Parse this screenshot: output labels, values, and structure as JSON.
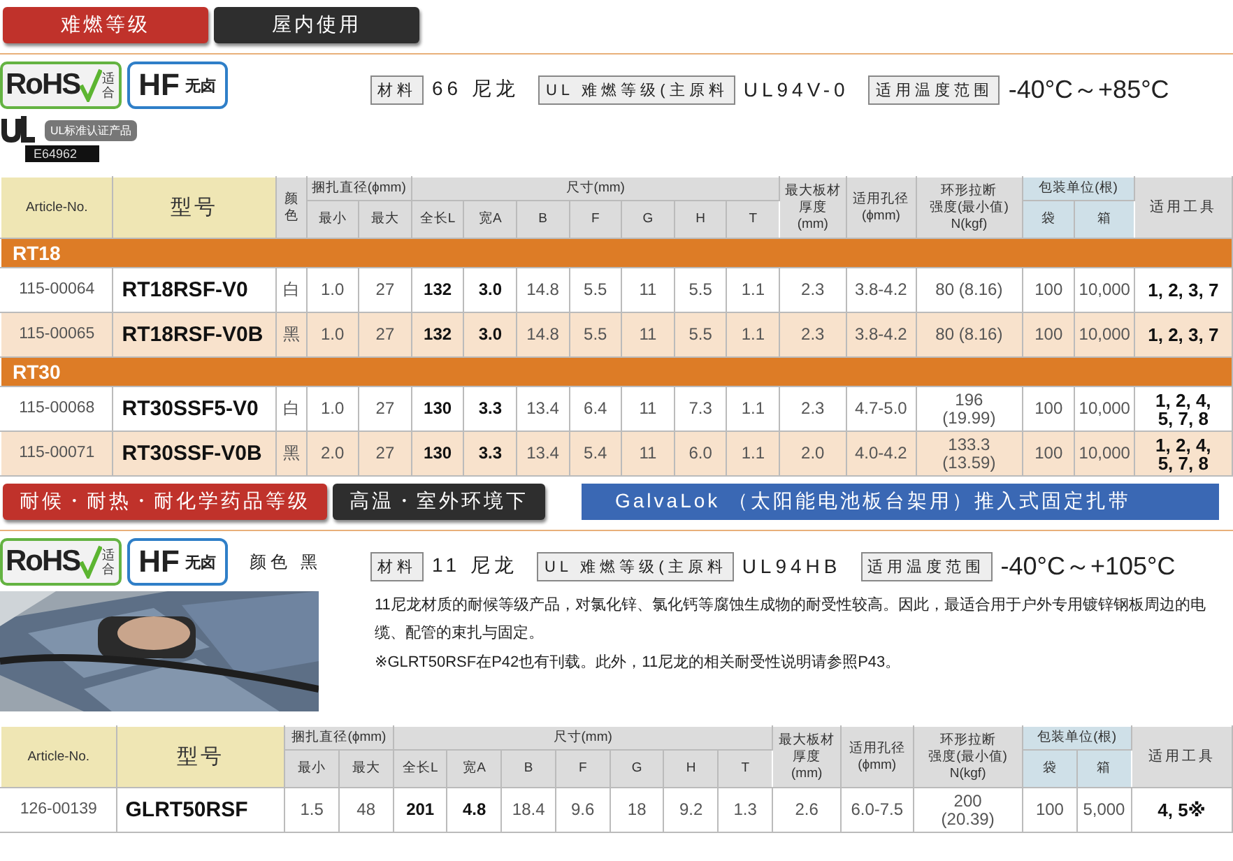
{
  "sections": [
    {
      "tags": [
        {
          "label": "难燃等级",
          "color": "#c0322b"
        },
        {
          "label": "屋内使用",
          "color": "#2e2e2e"
        }
      ],
      "rohs": {
        "mark": "RoHS",
        "label": "适合"
      },
      "hf": {
        "mark": "HF",
        "label": "无卤"
      },
      "ul": {
        "label": "UL标准认证产品",
        "number": "E64962"
      },
      "specs": [
        {
          "label": "材料",
          "value": "66 尼龙"
        },
        {
          "label": "UL 难燃等级(主原料",
          "value": "UL94V-0"
        },
        {
          "label": "适用温度范围",
          "value": "-40°C～+85°C",
          "kind": "temp"
        }
      ],
      "table": {
        "columns": [
          {
            "lines": [
              "Article-No."
            ],
            "kind": "id"
          },
          {
            "lines": [
              "型号"
            ],
            "kind": "model"
          },
          {
            "lines": [
              "颜",
              "色"
            ],
            "kind": "narrow"
          },
          {
            "lines": [
              "捆扎直径(ϕmm)"
            ],
            "colspan": 2,
            "subs": [
              {
                "label": "最小"
              },
              {
                "label": "最大"
              }
            ]
          },
          {
            "lines": [
              "尺寸(mm)"
            ],
            "colspan": 7,
            "subs": [
              {
                "label": "全长L",
                "kind": "key"
              },
              {
                "label": "宽A",
                "kind": "key"
              },
              {
                "label": "B"
              },
              {
                "label": "F"
              },
              {
                "label": "G"
              },
              {
                "label": "H"
              },
              {
                "label": "T"
              }
            ]
          },
          {
            "lines": [
              "最大板材",
              "厚度",
              "(mm)"
            ],
            "kind": "thick"
          },
          {
            "lines": [
              "适用孔径",
              "(ϕmm)"
            ],
            "kind": "hole"
          },
          {
            "lines": [
              "环形拉断",
              "强度(最小值)",
              "N(kgf)"
            ],
            "kind": "tensile"
          },
          {
            "lines": [
              "包装单位(根)"
            ],
            "kind": "pack",
            "colspan": 2,
            "subs": [
              {
                "label": "袋"
              },
              {
                "label": "箱"
              }
            ]
          },
          {
            "lines": [
              "适用工具"
            ],
            "kind": "tools"
          }
        ],
        "rows": [
          {
            "kind": "group",
            "label": "RT18"
          },
          {
            "kind": "item",
            "shaded": false,
            "cells": [
              "115-00064",
              "RT18RSF-V0",
              "白",
              "1.0",
              "27",
              "132",
              "3.0",
              "14.8",
              "5.5",
              "11",
              "5.5",
              "1.1",
              "2.3",
              "3.8-4.2",
              "80 (8.16)",
              "100",
              "10,000",
              "1, 2, 3, 7"
            ]
          },
          {
            "kind": "item",
            "shaded": true,
            "cells": [
              "115-00065",
              "RT18RSF-V0B",
              "黑",
              "1.0",
              "27",
              "132",
              "3.0",
              "14.8",
              "5.5",
              "11",
              "5.5",
              "1.1",
              "2.3",
              "3.8-4.2",
              "80 (8.16)",
              "100",
              "10,000",
              "1, 2, 3, 7"
            ]
          },
          {
            "kind": "group",
            "label": "RT30"
          },
          {
            "kind": "item",
            "shaded": false,
            "cells": [
              "115-00068",
              "RT30SSF5-V0",
              "白",
              "1.0",
              "27",
              "130",
              "3.3",
              "13.4",
              "6.4",
              "11",
              "7.3",
              "1.1",
              "2.3",
              "4.7-5.0",
              "196\n(19.99)",
              "100",
              "10,000",
              "1, 2, 4,\n5, 7, 8"
            ]
          },
          {
            "kind": "item",
            "shaded": true,
            "cells": [
              "115-00071",
              "RT30SSF-V0B",
              "黑",
              "2.0",
              "27",
              "130",
              "3.3",
              "13.4",
              "5.4",
              "11",
              "6.0",
              "1.1",
              "2.0",
              "4.0-4.2",
              "133.3\n(13.59)",
              "100",
              "10,000",
              "1, 2, 4,\n5, 7, 8"
            ]
          }
        ]
      }
    },
    {
      "tags": [
        {
          "label": "耐候・耐热・耐化学药品等级",
          "color": "#c0322b"
        },
        {
          "label": "高温・室外环境下",
          "color": "#2e2e2e"
        },
        {
          "label": "GalvaLok （太阳能电池板台架用）推入式固定扎带",
          "color": "#3a68b4",
          "kind": "wide"
        }
      ],
      "rohs": {
        "mark": "RoHS",
        "label": "适合"
      },
      "hf": {
        "mark": "HF",
        "label": "无卤"
      },
      "note": "颜色 黑",
      "specs": [
        {
          "label": "材料",
          "value": "11 尼龙"
        },
        {
          "label": "UL 难燃等级(主原料",
          "value": "UL94HB"
        },
        {
          "label": "适用温度范围",
          "value": "-40°C～+105°C",
          "kind": "temp"
        }
      ],
      "photo": {
        "kind": "picture"
      },
      "description": [
        "11尼龙材质的耐候等级产品，对氯化锌、氯化钙等腐蚀生成物的耐受性较高。因此，最适合用于户外专用镀锌钢板周边的电缆、配管的束扎与固定。",
        "※GLRT50RSF在P42也有刊载。此外，11尼龙的相关耐受性说明请参照P43。"
      ],
      "table": {
        "columns": [
          {
            "lines": [
              "Article-No."
            ],
            "kind": "id"
          },
          {
            "lines": [
              "型号"
            ],
            "kind": "model"
          },
          {
            "lines": [
              "捆扎直径(ϕmm)"
            ],
            "colspan": 2,
            "subs": [
              {
                "label": "最小"
              },
              {
                "label": "最大"
              }
            ]
          },
          {
            "lines": [
              "尺寸(mm)"
            ],
            "colspan": 7,
            "subs": [
              {
                "label": "全长L",
                "kind": "key"
              },
              {
                "label": "宽A",
                "kind": "key"
              },
              {
                "label": "B"
              },
              {
                "label": "F"
              },
              {
                "label": "G"
              },
              {
                "label": "H"
              },
              {
                "label": "T"
              }
            ]
          },
          {
            "lines": [
              "最大板材",
              "厚度",
              "(mm)"
            ],
            "kind": "thick"
          },
          {
            "lines": [
              "适用孔径",
              "(ϕmm)"
            ],
            "kind": "hole"
          },
          {
            "lines": [
              "环形拉断",
              "强度(最小值)",
              "N(kgf)"
            ],
            "kind": "tensile"
          },
          {
            "lines": [
              "包装单位(根)"
            ],
            "kind": "pack",
            "colspan": 2,
            "subs": [
              {
                "label": "袋"
              },
              {
                "label": "箱"
              }
            ]
          },
          {
            "lines": [
              "适用工具"
            ],
            "kind": "tools"
          }
        ],
        "rows": [
          {
            "kind": "item",
            "shaded": false,
            "cells": [
              "126-00139",
              "GLRT50RSF",
              "1.5",
              "48",
              "201",
              "4.8",
              "18.4",
              "9.6",
              "18",
              "9.2",
              "1.3",
              "2.6",
              "6.0-7.5",
              "200\n(20.39)",
              "100",
              "5,000",
              "4, 5※"
            ]
          }
        ]
      }
    }
  ]
}
